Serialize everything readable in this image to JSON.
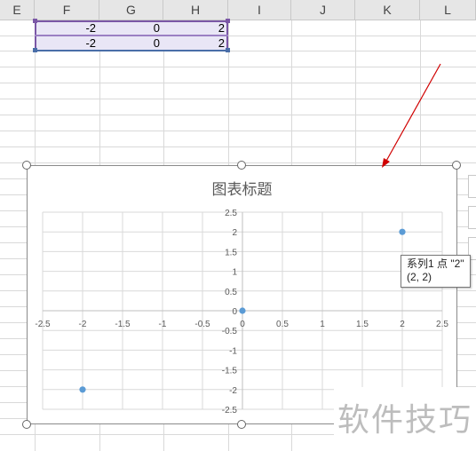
{
  "spreadsheet": {
    "columns": [
      "E",
      "F",
      "G",
      "H",
      "I",
      "J",
      "K",
      "L"
    ],
    "rows": [
      [
        "-2",
        "0",
        "2"
      ],
      [
        "-2",
        "0",
        "2"
      ]
    ]
  },
  "chart": {
    "title": "图表标题"
  },
  "tooltip": {
    "line1": "系列1 点 \"2\"",
    "line2": "(2, 2)"
  },
  "watermark": "软件技巧",
  "colors": {
    "series": "#5b9bd5",
    "arrow": "#d00000",
    "selection": "#7b57a6"
  },
  "chart_data": {
    "type": "scatter",
    "title": "图表标题",
    "xlim": [
      -2.5,
      2.5
    ],
    "ylim": [
      -2.5,
      2.5
    ],
    "x_ticks": [
      "-2.5",
      "-2",
      "-1.5",
      "-1",
      "-0.5",
      "0",
      "0.5",
      "1",
      "1.5",
      "2",
      "2.5"
    ],
    "y_ticks": [
      "2.5",
      "2",
      "1.5",
      "1",
      "0.5",
      "0",
      "-0.5",
      "-1",
      "-1.5",
      "-2",
      "-2.5"
    ],
    "grid": true,
    "series": [
      {
        "points": [
          [
            -2,
            -2
          ],
          [
            0,
            0
          ],
          [
            2,
            2
          ]
        ]
      }
    ]
  }
}
